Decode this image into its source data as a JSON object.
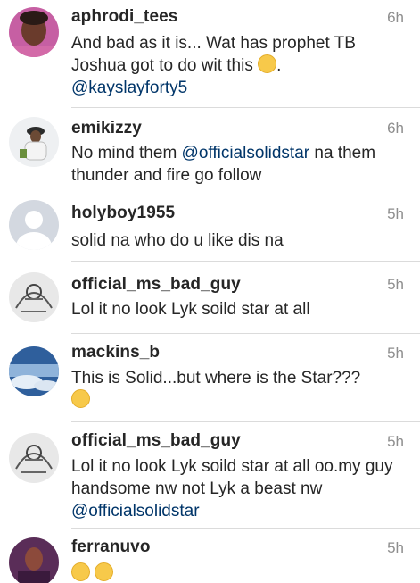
{
  "comments": [
    {
      "username": "aphrodi_tees",
      "time": "6h",
      "text_parts": [
        "And bad as it is... Wat has prophet TB Joshua got to do wit this",
        ".",
        "@kayslayforty5"
      ],
      "emoji": [
        "relieved-face-emoji"
      ]
    },
    {
      "username": "emikizzy",
      "time": "6h",
      "text_parts": [
        "No mind them ",
        "@officialsolidstar",
        " na them thunder and fire go follow"
      ]
    },
    {
      "username": "holyboy1955",
      "time": "5h",
      "text": "solid na who do u like dis na"
    },
    {
      "username": "official_ms_bad_guy",
      "time": "5h",
      "text": "Lol it no look Lyk soild star at all"
    },
    {
      "username": "mackins_b",
      "time": "5h",
      "text": "This is Solid...but where is the Star???",
      "emoji": [
        "rolling-eyes-emoji"
      ]
    },
    {
      "username": "official_ms_bad_guy",
      "time": "5h",
      "text": "Lol it no look Lyk soild star at all oo.my guy handsome nw not Lyk a beast nw",
      "mention": "@officialsolidstar"
    },
    {
      "username": "ferranuvo",
      "time": "5h",
      "emoji": [
        "weary-face-emoji",
        "weary-face-emoji"
      ]
    }
  ],
  "colors": {
    "text": "#262626",
    "time": "#8e8e8e",
    "mention": "#003569",
    "divider": "#dbdbdb"
  }
}
